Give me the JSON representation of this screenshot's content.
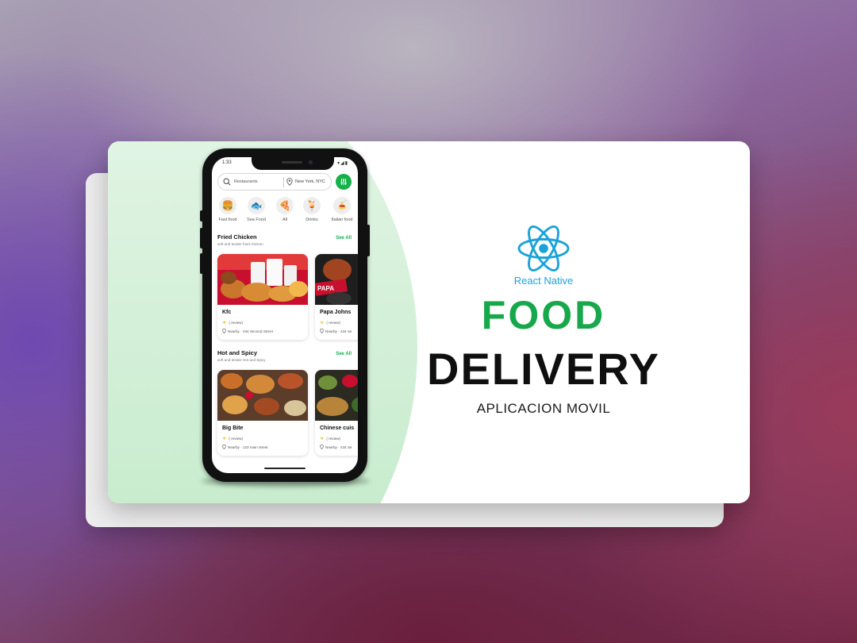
{
  "hero": {
    "framework_label": "React Native",
    "title_line1": "FOOD",
    "title_line2": "DELIVERY",
    "subtitle": "APLICACION MOVIL",
    "colors": {
      "accent_green": "#16a84a",
      "react_blue": "#1aa3d9"
    }
  },
  "app": {
    "status_time": "1:33",
    "search": {
      "placeholder": "Restaurants",
      "location": "New York, NYC"
    },
    "categories": [
      {
        "label": "Fast food",
        "icon": "burger-icon"
      },
      {
        "label": "Sea Food",
        "icon": "fish-icon"
      },
      {
        "label": "All",
        "icon": "pizza-icon"
      },
      {
        "label": "Drinks",
        "icon": "drink-icon"
      },
      {
        "label": "Italian food",
        "icon": "pasta-icon"
      }
    ],
    "sections": [
      {
        "title": "Fried Chicken",
        "subtitle": "soft and tender fried chicken",
        "see_all": "See All",
        "restaurants": [
          {
            "name": "Kfc",
            "rating": "( review)",
            "address": "Nearby · 434 Second Street"
          },
          {
            "name": "Papa Johns",
            "rating": "( review)",
            "address": "Nearby · 434 Se"
          }
        ]
      },
      {
        "title": "Hot and Spicy",
        "subtitle": "soft and tender Hot and Spicy",
        "see_all": "See All",
        "restaurants": [
          {
            "name": "Big Bite",
            "rating": "( review)",
            "address": "Nearby · 123 main street"
          },
          {
            "name": "Chinese cuis",
            "rating": "( review)",
            "address": "Nearby · 434 Se"
          }
        ]
      }
    ]
  }
}
